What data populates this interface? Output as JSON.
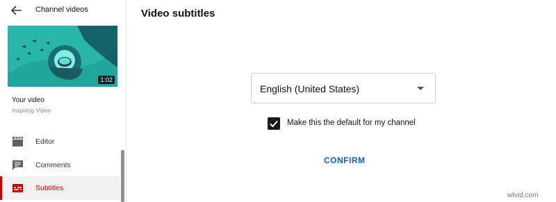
{
  "sidebar": {
    "title": "Channel videos",
    "thumbnail": {
      "duration": "1:02"
    },
    "your_video_label": "Your video",
    "video_title": "Inspiring Video",
    "items": [
      {
        "label": "Editor",
        "icon": "clapperboard-icon"
      },
      {
        "label": "Comments",
        "icon": "comment-icon"
      },
      {
        "label": "Subtitles",
        "icon": "subtitles-icon",
        "active": true
      }
    ]
  },
  "main": {
    "title": "Video subtitles",
    "language_select": {
      "value": "English (United States)"
    },
    "default_checkbox": {
      "label": "Make this the default for my channel",
      "checked": true
    },
    "confirm_label": "CONFIRM"
  },
  "watermark": "wtvid.com",
  "colors": {
    "accent_red": "#cc0000",
    "link_blue": "#065fd4"
  }
}
